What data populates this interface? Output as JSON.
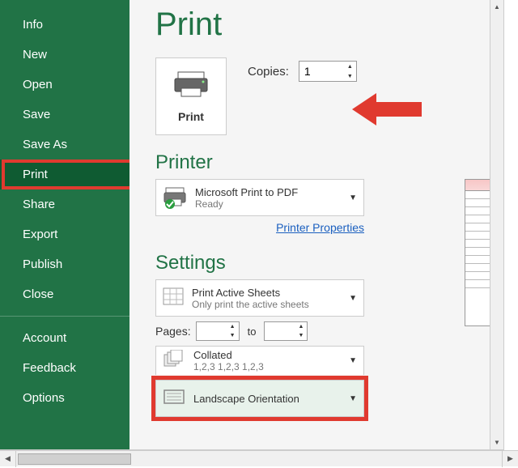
{
  "sidebar": {
    "items": [
      {
        "label": "Info"
      },
      {
        "label": "New"
      },
      {
        "label": "Open"
      },
      {
        "label": "Save"
      },
      {
        "label": "Save As"
      },
      {
        "label": "Print"
      },
      {
        "label": "Share"
      },
      {
        "label": "Export"
      },
      {
        "label": "Publish"
      },
      {
        "label": "Close"
      }
    ],
    "items2": [
      {
        "label": "Account"
      },
      {
        "label": "Feedback"
      },
      {
        "label": "Options"
      }
    ],
    "active_index": 5
  },
  "title": "Print",
  "print_button_label": "Print",
  "copies": {
    "label": "Copies:",
    "value": "1"
  },
  "printer_section": "Printer",
  "printer": {
    "name": "Microsoft Print to PDF",
    "status": "Ready"
  },
  "printer_properties": "Printer Properties",
  "settings_section": "Settings",
  "active_sheets": {
    "line1": "Print Active Sheets",
    "line2": "Only print the active sheets"
  },
  "pages": {
    "label": "Pages:",
    "to": "to"
  },
  "collated": {
    "line1": "Collated",
    "line2": "1,2,3   1,2,3   1,2,3"
  },
  "orientation": {
    "label": "Landscape Orientation"
  },
  "colors": {
    "green": "#217346",
    "red": "#e03a2f"
  }
}
